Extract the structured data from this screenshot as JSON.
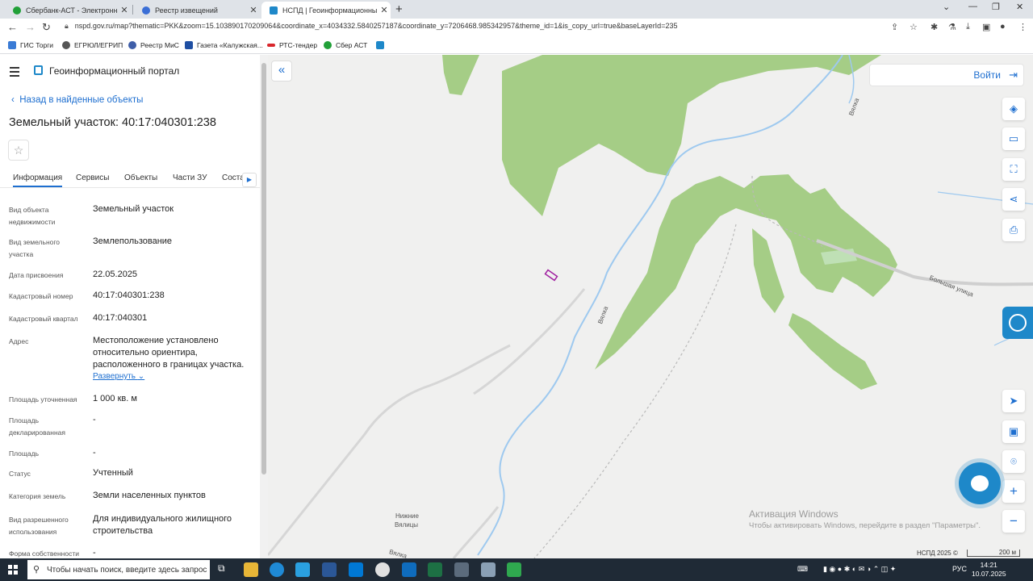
{
  "browser": {
    "tabs": [
      {
        "title": "Сбербанк-АСТ - Электронная т",
        "icon": "sberbank-icon",
        "active": false
      },
      {
        "title": "Реестр извещений",
        "icon": "registry-icon",
        "active": false
      },
      {
        "title": "НСПД | Геоинформационный п",
        "icon": "nspd-icon",
        "active": true
      }
    ],
    "new_tab": "+",
    "url": "nspd.gov.ru/map?thematic=PKK&zoom=15.103890170209064&coordinate_x=4034332.5840257187&coordinate_y=7206468.985342957&theme_id=1&is_copy_url=true&baseLayerId=235",
    "bookmarks": [
      "ГИС Торги",
      "ЕГРЮЛ/ЕГРИП",
      "Реестр МиС",
      "Газета «Калужская...",
      "РТС-тендер",
      "Сбер АСТ"
    ]
  },
  "panel": {
    "portal_title": "Геоинформационный портал",
    "back_label": "Назад в найденные объекты",
    "object_title": "Земельный участок: 40:17:040301:238",
    "tabs": [
      "Информация",
      "Сервисы",
      "Объекты",
      "Части ЗУ",
      "Соста"
    ],
    "properties": [
      {
        "label": "Вид объекта недвижимости",
        "value": "Земельный участок"
      },
      {
        "label": "Вид земельного участка",
        "value": "Землепользование"
      },
      {
        "label": "Дата присвоения",
        "value": "22.05.2025"
      },
      {
        "label": "Кадастровый номер",
        "value": "40:17:040301:238"
      },
      {
        "label": "Кадастровый квартал",
        "value": "40:17:040301"
      },
      {
        "label": "Адрес",
        "value": "Местоположение установлено относительно ориентира, расположенного в границах участка."
      },
      {
        "label": "Площадь уточненная",
        "value": "1 000 кв. м"
      },
      {
        "label": "Площадь декларированная",
        "value": "-"
      },
      {
        "label": "Площадь",
        "value": "-"
      },
      {
        "label": "Статус",
        "value": "Учтенный"
      },
      {
        "label": "Категория земель",
        "value": "Земли населенных пунктов"
      },
      {
        "label": "Вид разрешенного использования",
        "value": "Для индивидуального жилищного строительства"
      },
      {
        "label": "Форма собственности",
        "value": "-"
      }
    ],
    "expand_label": "Развернуть"
  },
  "map": {
    "login_label": "Войти",
    "labels": {
      "river_upper": "Вялка",
      "river_mid": "Вялка",
      "river_lower": "Вялка",
      "street": "Большая улица",
      "village_line1": "Нижние",
      "village_line2": "Вялицы"
    },
    "watermark": {
      "line1": "Активация Windows",
      "line2": "Чтобы активировать Windows, перейдите в раздел \"Параметры\"."
    },
    "attribution": "НСПД 2025 ©",
    "scale": "200 м",
    "tools": [
      "layers-icon",
      "ruler-icon",
      "select-area-icon",
      "share-icon",
      "print-icon"
    ],
    "bottom_tools": [
      "locate-icon",
      "minimap-icon",
      "geo-pin-icon",
      "zoom-in-icon",
      "zoom-out-icon"
    ],
    "colors": {
      "forest": "#a5cd86",
      "water": "#9ec9ef",
      "parcel": "#a020a0"
    }
  },
  "taskbar": {
    "search_placeholder": "Чтобы начать поиск, введите здесь запрос",
    "lang": "РУС",
    "time": "14:21",
    "date": "10.07.2025"
  }
}
